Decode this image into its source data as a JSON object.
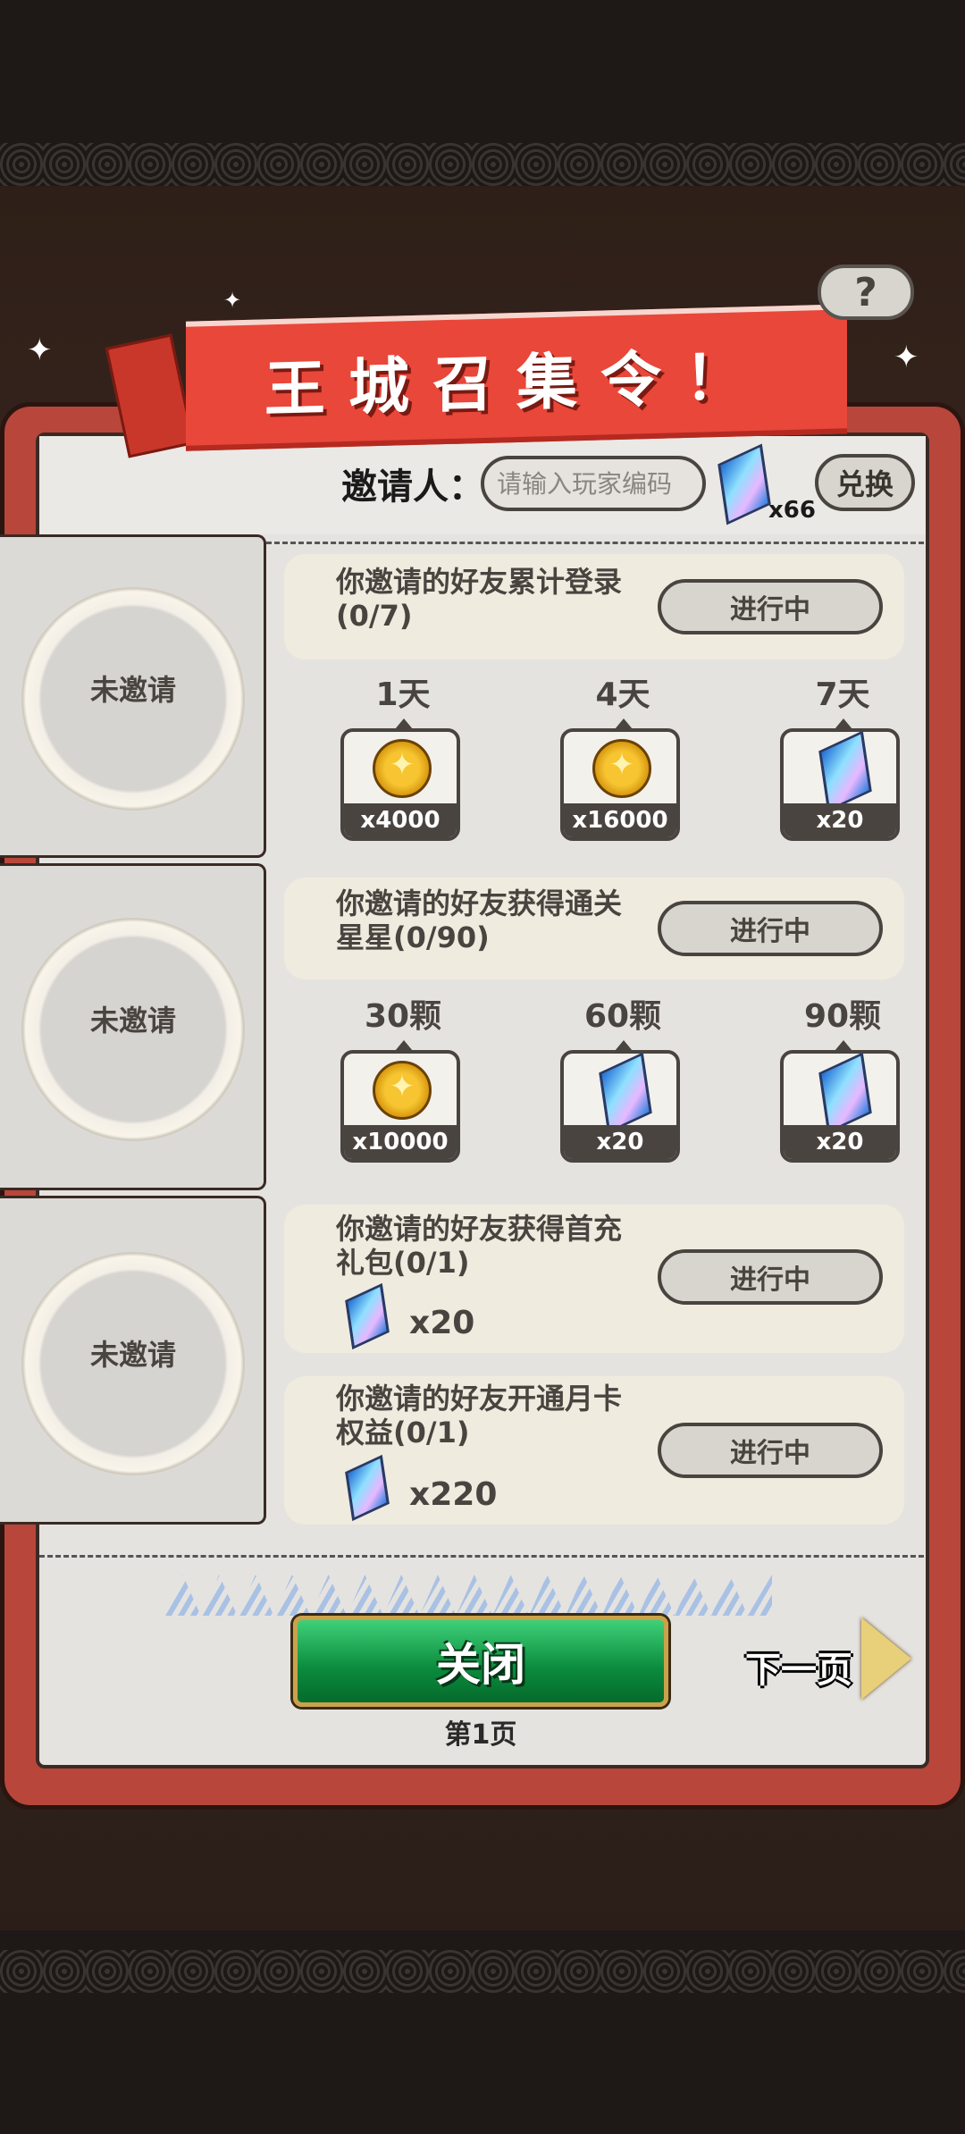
{
  "title": "王城召集令！",
  "help_label": "?",
  "inviter": {
    "label": "邀请人：",
    "placeholder": "请输入玩家编码",
    "gem_count": "x66",
    "exchange_label": "兑换"
  },
  "slots": [
    {
      "label": "未邀请"
    },
    {
      "label": "未邀请"
    },
    {
      "label": "未邀请"
    }
  ],
  "tasks": [
    {
      "text": "你邀请的好友累计登录\n(0/7)",
      "status": "进行中",
      "rewards": [
        {
          "label": "1天",
          "icon": "gold-coin",
          "qty": "x4000"
        },
        {
          "label": "4天",
          "icon": "gold-coin",
          "qty": "x16000"
        },
        {
          "label": "7天",
          "icon": "blue-gem",
          "qty": "x20"
        }
      ]
    },
    {
      "text": "你邀请的好友获得通关\n星星(0/90)",
      "status": "进行中",
      "rewards": [
        {
          "label": "30颗",
          "icon": "gold-coin",
          "qty": "x10000"
        },
        {
          "label": "60颗",
          "icon": "blue-gem",
          "qty": "x20"
        },
        {
          "label": "90颗",
          "icon": "blue-gem",
          "qty": "x20"
        }
      ]
    },
    {
      "text": "你邀请的好友获得首充\n礼包(0/1)",
      "status": "进行中",
      "reward_qty": "x20",
      "reward_icon": "blue-gem"
    },
    {
      "text": "你邀请的好友开通月卡\n权益(0/1)",
      "status": "进行中",
      "reward_qty": "x220",
      "reward_icon": "blue-gem"
    }
  ],
  "footer": {
    "close_label": "关闭",
    "page_label": "第1页",
    "next_label": "下一页"
  }
}
